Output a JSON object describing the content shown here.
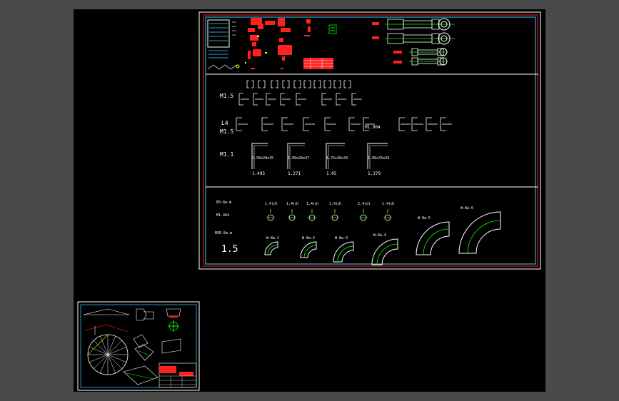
{
  "colors": {
    "background": "#000000",
    "outer_bg": "#4a4a4a",
    "frame_white": "#ffffff",
    "frame_red": "#ff2020",
    "frame_cyan": "#40d0ff",
    "green": "#00ff00",
    "yellow": "#ffff00"
  },
  "sheet_a": {
    "row_labels": {
      "r1": "M1.5",
      "r2a": "L4",
      "r2b": "M1.5",
      "r3": "M1.1"
    },
    "angle_labels": [
      {
        "dims": "1.99x20x35",
        "thick": "1.495"
      },
      {
        "dims": "1.99x20x37",
        "thick": "1.271"
      },
      {
        "dims": "1.75x20x33",
        "thick": "1.05"
      },
      {
        "dims": "1.99x33x33",
        "thick": "1.379"
      }
    ],
    "channel_mid_label": "M1.964",
    "bottom": {
      "left_labels": [
        "ER-8a-m",
        "M1.464",
        "BSR-8a-m",
        "1.5"
      ],
      "bolt_labels": [
        "1.4(d)",
        "1.4(d)",
        "1.4(d)",
        "1.4(d)",
        "2.4(d)",
        "1.4(d)"
      ],
      "elbow_labels": [
        "W-8a-1",
        "W-8a-2",
        "W-8a-3",
        "W-8a-4",
        "W-8a-5",
        "W-8a-6"
      ]
    }
  },
  "sheet_b": {
    "icons": [
      "pie-icon",
      "elbow-icon",
      "flange-icon",
      "title-block-icon"
    ]
  }
}
